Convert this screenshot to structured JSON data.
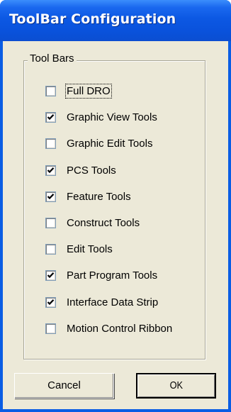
{
  "window": {
    "title": "ToolBar Configuration"
  },
  "group": {
    "label": "Tool Bars"
  },
  "checkboxes": [
    {
      "label": "Full DRO",
      "checked": false,
      "focused": true
    },
    {
      "label": "Graphic View Tools",
      "checked": true
    },
    {
      "label": "Graphic Edit Tools",
      "checked": false
    },
    {
      "label": "PCS Tools",
      "checked": true
    },
    {
      "label": "Feature Tools",
      "checked": true
    },
    {
      "label": "Construct Tools",
      "checked": false
    },
    {
      "label": "Edit Tools",
      "checked": false
    },
    {
      "label": "Part Program Tools",
      "checked": true
    },
    {
      "label": "Interface Data Strip",
      "checked": true
    },
    {
      "label": "Motion Control Ribbon",
      "checked": false
    }
  ],
  "buttons": {
    "cancel": "Cancel",
    "ok": "OK"
  },
  "colors": {
    "title_bar": "#0a5de4",
    "dialog_face": "#ece9d8",
    "title_text": "#ffffff"
  },
  "icons": {
    "check": "check-mark-icon"
  }
}
